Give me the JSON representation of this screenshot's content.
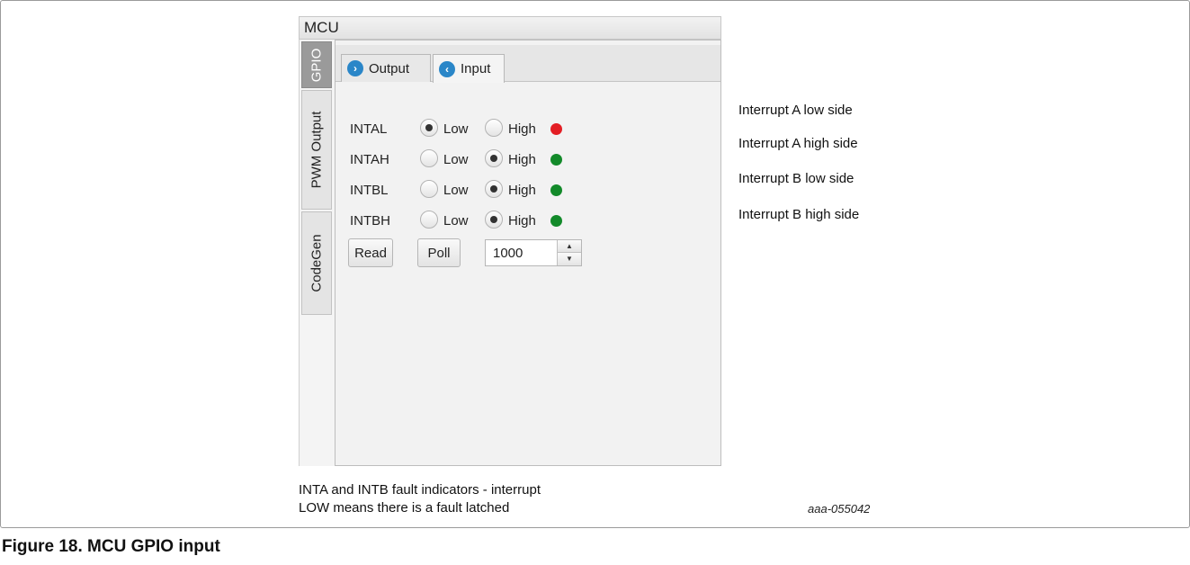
{
  "panel": {
    "title": "MCU",
    "side_tabs": [
      {
        "label": "GPIO",
        "active": true
      },
      {
        "label": "PWM Output",
        "active": false
      },
      {
        "label": "CodeGen",
        "active": false
      }
    ],
    "tabs": [
      {
        "label": "Output",
        "icon": "chevron-right-icon",
        "active": false
      },
      {
        "label": "Input",
        "icon": "chevron-left-icon",
        "active": true
      }
    ],
    "signals": [
      {
        "name": "INTAL",
        "low_label": "Low",
        "high_label": "High",
        "selected": "Low",
        "indicator": "red",
        "indicator_color": "#e31e24",
        "annotation": "Interrupt A low side"
      },
      {
        "name": "INTAH",
        "low_label": "Low",
        "high_label": "High",
        "selected": "High",
        "indicator": "green",
        "indicator_color": "#138a2a",
        "annotation": "Interrupt A high side"
      },
      {
        "name": "INTBL",
        "low_label": "Low",
        "high_label": "High",
        "selected": "High",
        "indicator": "green",
        "indicator_color": "#138a2a",
        "annotation": "Interrupt B low side"
      },
      {
        "name": "INTBH",
        "low_label": "Low",
        "high_label": "High",
        "selected": "High",
        "indicator": "green",
        "indicator_color": "#138a2a",
        "annotation": "Interrupt B high side"
      }
    ],
    "read_button": "Read",
    "poll_button": "Poll",
    "poll_interval": "1000"
  },
  "note": {
    "line1": "INTA and INTB fault indicators - interrupt",
    "line2": "LOW means there is a fault latched"
  },
  "figure_ref": "aaa-055042",
  "caption": "Figure 18.  MCU GPIO input"
}
